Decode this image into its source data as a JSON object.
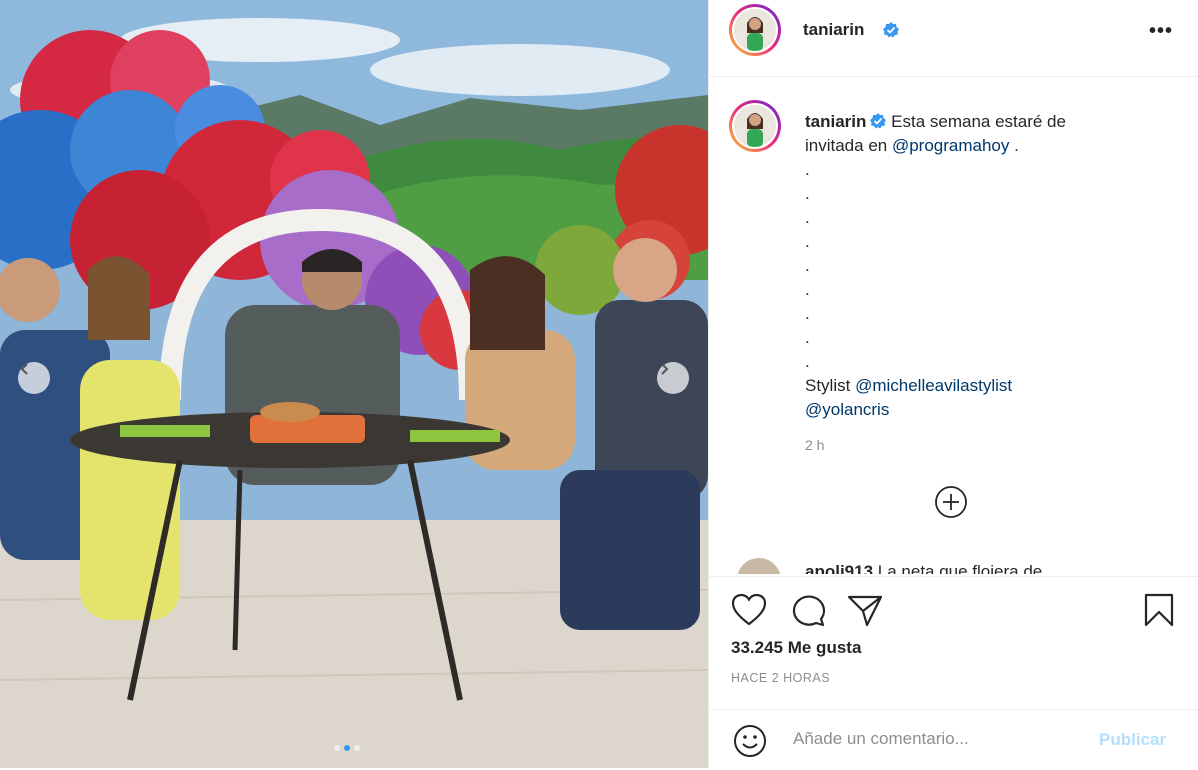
{
  "post": {
    "username": "taniarin",
    "verified": true,
    "more_icon": "more-horizontal-icon",
    "caption": {
      "username": "taniarin",
      "text_before": "Esta semana estaré de invitada en ",
      "mention_1": "@programahoy",
      "text_after": " .",
      "dots": [
        ".",
        ".",
        ".",
        ".",
        ".",
        ".",
        ".",
        ".",
        "."
      ],
      "stylist_label": "Stylist ",
      "mention_2": "@michelleavilastylist",
      "mention_3": "@yolancris"
    },
    "caption_time": "2 h",
    "load_more_icon": "plus-circle-icon",
    "peek_comment": {
      "username": "apoli913",
      "text": "La neta que flojera de"
    },
    "likes": "33.245 Me gusta",
    "posted": "HACE 2 HORAS",
    "comment": {
      "placeholder": "Añade un comentario...",
      "publish": "Publicar"
    },
    "carousel": {
      "slides": 3,
      "active_slide": 2
    }
  },
  "colors": {
    "verified": "#3897f0",
    "link": "#00376b",
    "publish_disabled": "#b2dffc",
    "muted": "#8e8e8e"
  }
}
